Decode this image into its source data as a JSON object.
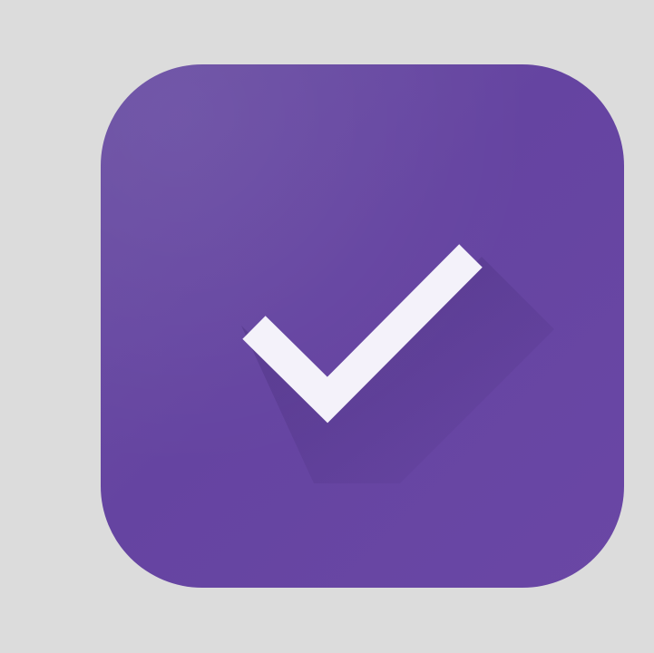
{
  "icon": {
    "name": "checkmark-app-icon",
    "background_color": "#6644a0",
    "glyph": "check-icon",
    "glyph_color": "#f4f2fa",
    "page_background": "#dcdcdc"
  }
}
